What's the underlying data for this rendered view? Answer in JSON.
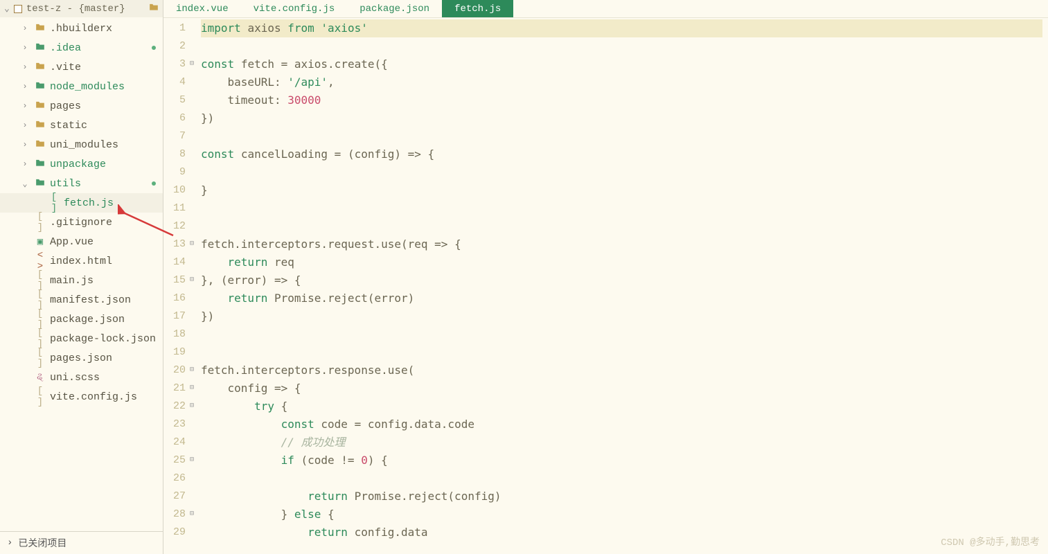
{
  "sidebar": {
    "project_name": "test-z - {master}",
    "tree": [
      {
        "type": "folder",
        "label": ".hbuilderx",
        "indent": 1,
        "arrow": ">",
        "color": "folder"
      },
      {
        "type": "folder",
        "label": ".idea",
        "indent": 1,
        "arrow": ">",
        "color": "folder-green",
        "labelClass": "green",
        "dot": true
      },
      {
        "type": "folder",
        "label": ".vite",
        "indent": 1,
        "arrow": ">",
        "color": "folder"
      },
      {
        "type": "folder",
        "label": "node_modules",
        "indent": 1,
        "arrow": ">",
        "color": "folder-green",
        "labelClass": "green"
      },
      {
        "type": "folder",
        "label": "pages",
        "indent": 1,
        "arrow": ">",
        "color": "folder"
      },
      {
        "type": "folder",
        "label": "static",
        "indent": 1,
        "arrow": ">",
        "color": "folder"
      },
      {
        "type": "folder",
        "label": "uni_modules",
        "indent": 1,
        "arrow": ">",
        "color": "folder"
      },
      {
        "type": "folder",
        "label": "unpackage",
        "indent": 1,
        "arrow": ">",
        "color": "folder-green",
        "labelClass": "green"
      },
      {
        "type": "folder",
        "label": "utils",
        "indent": 1,
        "arrow": "v",
        "color": "folder-green",
        "labelClass": "green",
        "dot": true
      },
      {
        "type": "file",
        "label": "fetch.js",
        "indent": 2,
        "icon": "file-green",
        "labelClass": "green",
        "selected": true
      },
      {
        "type": "file",
        "label": ".gitignore",
        "indent": 1,
        "icon": "file"
      },
      {
        "type": "file",
        "label": "App.vue",
        "indent": 1,
        "icon": "vue"
      },
      {
        "type": "file",
        "label": "index.html",
        "indent": 1,
        "icon": "html"
      },
      {
        "type": "file",
        "label": "main.js",
        "indent": 1,
        "icon": "file"
      },
      {
        "type": "file",
        "label": "manifest.json",
        "indent": 1,
        "icon": "file"
      },
      {
        "type": "file",
        "label": "package.json",
        "indent": 1,
        "icon": "file"
      },
      {
        "type": "file",
        "label": "package-lock.json",
        "indent": 1,
        "icon": "file"
      },
      {
        "type": "file",
        "label": "pages.json",
        "indent": 1,
        "icon": "file"
      },
      {
        "type": "file",
        "label": "uni.scss",
        "indent": 1,
        "icon": "sass"
      },
      {
        "type": "file",
        "label": "vite.config.js",
        "indent": 1,
        "icon": "file"
      }
    ],
    "footer": "已关闭项目"
  },
  "tabs": [
    {
      "label": "index.vue",
      "active": false
    },
    {
      "label": "vite.config.js",
      "active": false
    },
    {
      "label": "package.json",
      "active": false
    },
    {
      "label": "fetch.js",
      "active": true
    }
  ],
  "code": {
    "lines": [
      {
        "n": 1,
        "hl": true,
        "fold": "",
        "html": "<span class='kw'>import</span> <span class='plain'>axios </span><span class='kw'>from</span> <span class='str'>'axios'</span>"
      },
      {
        "n": 2,
        "hl": false,
        "fold": "",
        "html": ""
      },
      {
        "n": 3,
        "hl": false,
        "fold": "⊟",
        "html": "<span class='kw'>const</span> <span class='plain'>fetch = axios.</span><span class='fn'>create</span><span class='plain'>({</span>"
      },
      {
        "n": 4,
        "hl": false,
        "fold": "",
        "html": "    <span class='plain'>baseURL: </span><span class='str'>'/api'</span><span class='plain'>,</span>"
      },
      {
        "n": 5,
        "hl": false,
        "fold": "",
        "html": "    <span class='plain'>timeout: </span><span class='num'>30000</span>"
      },
      {
        "n": 6,
        "hl": false,
        "fold": "",
        "html": "<span class='plain'>})</span>"
      },
      {
        "n": 7,
        "hl": false,
        "fold": "",
        "html": ""
      },
      {
        "n": 8,
        "hl": false,
        "fold": "",
        "html": "<span class='kw'>const</span> <span class='plain'>cancelLoading = (config) =&gt; {</span>"
      },
      {
        "n": 9,
        "hl": false,
        "fold": "",
        "html": ""
      },
      {
        "n": 10,
        "hl": false,
        "fold": "",
        "html": "<span class='plain'>}</span>"
      },
      {
        "n": 11,
        "hl": false,
        "fold": "",
        "html": ""
      },
      {
        "n": 12,
        "hl": false,
        "fold": "",
        "html": ""
      },
      {
        "n": 13,
        "hl": false,
        "fold": "⊟",
        "html": "<span class='plain'>fetch.interceptors.request.</span><span class='fn'>use</span><span class='plain'>(req =&gt; {</span>"
      },
      {
        "n": 14,
        "hl": false,
        "fold": "",
        "html": "    <span class='kw'>return</span> <span class='plain'>req</span>"
      },
      {
        "n": 15,
        "hl": false,
        "fold": "⊟",
        "html": "<span class='plain'>}, (error) =&gt; {</span>"
      },
      {
        "n": 16,
        "hl": false,
        "fold": "",
        "html": "    <span class='kw'>return</span> <span class='plain'>Promise.</span><span class='fn'>reject</span><span class='plain'>(error)</span>"
      },
      {
        "n": 17,
        "hl": false,
        "fold": "",
        "html": "<span class='plain'>})</span>"
      },
      {
        "n": 18,
        "hl": false,
        "fold": "",
        "html": ""
      },
      {
        "n": 19,
        "hl": false,
        "fold": "",
        "html": ""
      },
      {
        "n": 20,
        "hl": false,
        "fold": "⊟",
        "html": "<span class='plain'>fetch.interceptors.response.</span><span class='fn'>use</span><span class='plain'>(</span>"
      },
      {
        "n": 21,
        "hl": false,
        "fold": "⊟",
        "html": "    <span class='plain'>config =&gt; {</span>"
      },
      {
        "n": 22,
        "hl": false,
        "fold": "⊟",
        "html": "        <span class='kw'>try</span> <span class='plain'>{</span>"
      },
      {
        "n": 23,
        "hl": false,
        "fold": "",
        "html": "            <span class='kw'>const</span> <span class='plain'>code = config.data.code</span>"
      },
      {
        "n": 24,
        "hl": false,
        "fold": "",
        "html": "            <span class='cm'>// 成功处理</span>"
      },
      {
        "n": 25,
        "hl": false,
        "fold": "⊟",
        "html": "            <span class='kw'>if</span> <span class='plain'>(code != </span><span class='num'>0</span><span class='plain'>) {</span>"
      },
      {
        "n": 26,
        "hl": false,
        "fold": "",
        "html": ""
      },
      {
        "n": 27,
        "hl": false,
        "fold": "",
        "html": "                <span class='kw'>return</span> <span class='plain'>Promise.</span><span class='fn'>reject</span><span class='plain'>(config)</span>"
      },
      {
        "n": 28,
        "hl": false,
        "fold": "⊟",
        "html": "            <span class='plain'>} </span><span class='kw'>else</span><span class='plain'> {</span>"
      },
      {
        "n": 29,
        "hl": false,
        "fold": "",
        "html": "                <span class='kw'>return</span> <span class='plain'>config.data</span>"
      }
    ]
  },
  "watermark": "CSDN @多动手,勤思考"
}
